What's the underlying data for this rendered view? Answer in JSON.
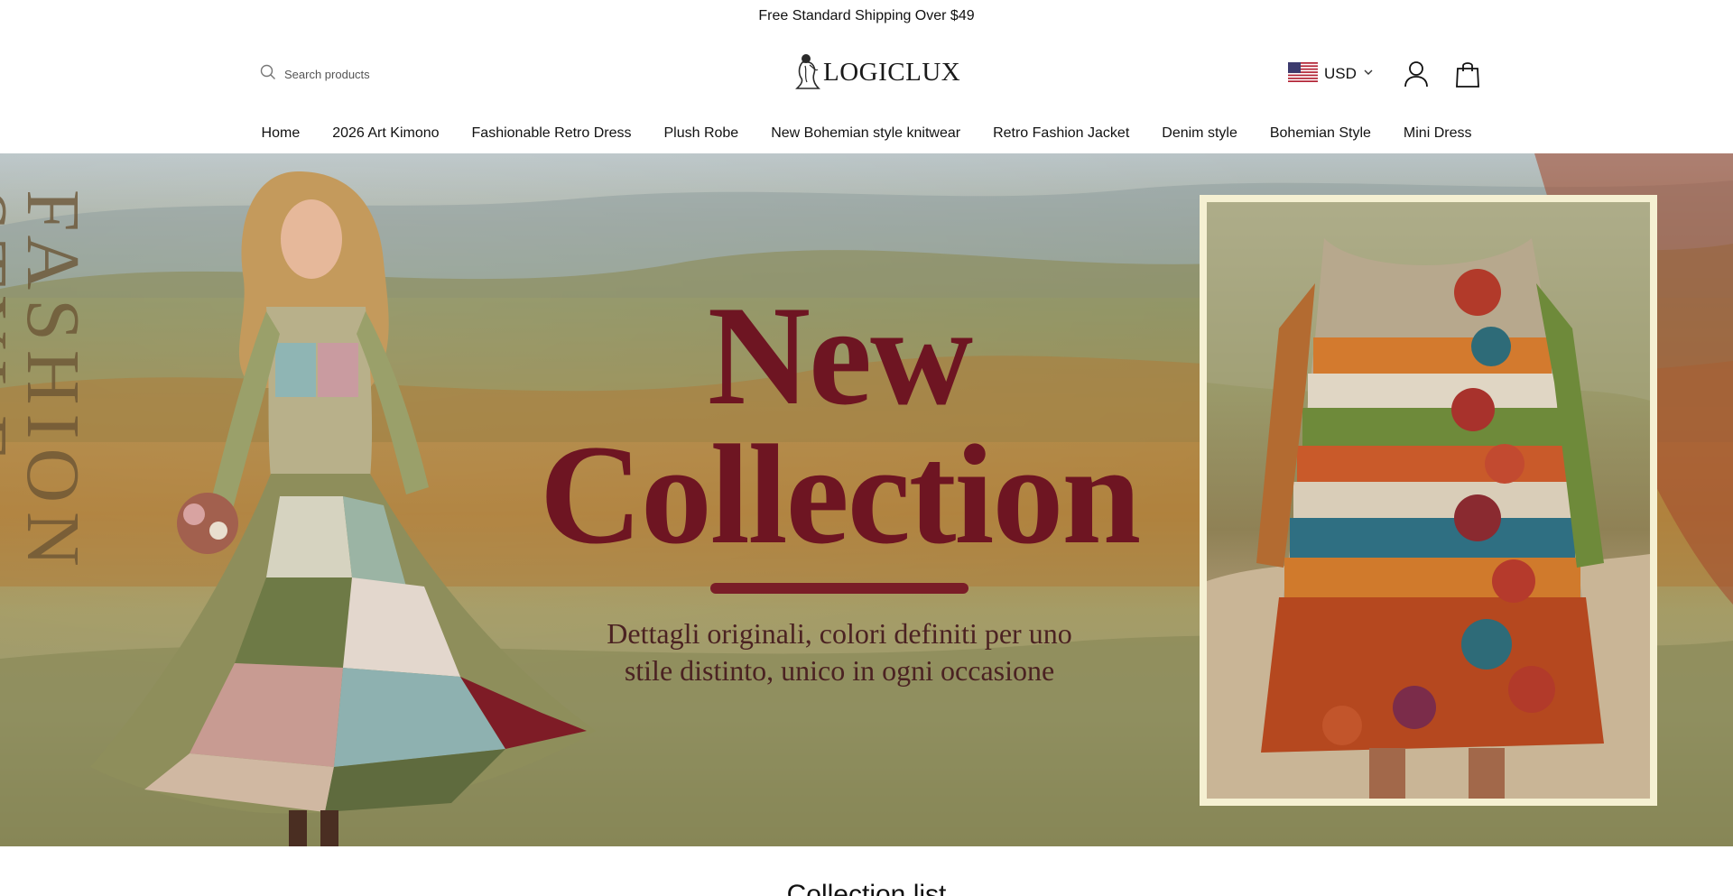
{
  "announcement": {
    "text": "Free Standard Shipping Over $49"
  },
  "header": {
    "search_placeholder": "Search products",
    "logo_text": "LOGICLUX",
    "currency": {
      "code": "USD",
      "flag": "us-flag-icon"
    },
    "icons": [
      "search-icon",
      "chevron-down-icon",
      "account-icon",
      "cart-bag-icon"
    ]
  },
  "nav": {
    "items": [
      "Home",
      "2026 Art Kimono",
      "Fashionable Retro Dress",
      "Plush Robe",
      "New Bohemian style knitwear",
      "Retro Fashion Jacket",
      "Denim style",
      "Bohemian Style",
      "Mini Dress"
    ]
  },
  "hero": {
    "vertical_text": "FASHION STYLE",
    "headline_line1": "New",
    "headline_line2": "Collection",
    "subtitle_line1": "Dettagli originali, colori definiti per uno",
    "subtitle_line2": "stile distinto, unico in ogni occasione",
    "accent_color": "#6e1522"
  },
  "sections": {
    "collection_title": "Collection list"
  }
}
